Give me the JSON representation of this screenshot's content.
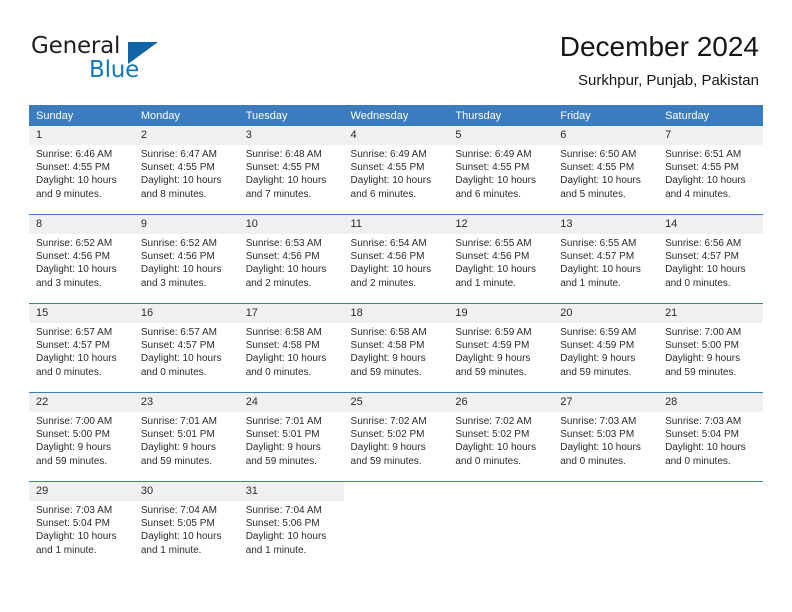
{
  "brand": {
    "name_top": "General",
    "name_bottom": "Blue",
    "triangle_color": "#1064a8",
    "blue_color": "#1277bc"
  },
  "header": {
    "title": "December 2024",
    "subtitle": "Surkhpur, Punjab, Pakistan"
  },
  "theme": {
    "header_bg": "#3b7cc0",
    "daynum_bg": "#f0f0f0",
    "text": "#2b2b2b"
  },
  "weekday_headers": [
    "Sunday",
    "Monday",
    "Tuesday",
    "Wednesday",
    "Thursday",
    "Friday",
    "Saturday"
  ],
  "weeks": [
    [
      {
        "day": "1",
        "sunrise": "Sunrise: 6:46 AM",
        "sunset": "Sunset: 4:55 PM",
        "daylight1": "Daylight: 10 hours",
        "daylight2": "and 9 minutes."
      },
      {
        "day": "2",
        "sunrise": "Sunrise: 6:47 AM",
        "sunset": "Sunset: 4:55 PM",
        "daylight1": "Daylight: 10 hours",
        "daylight2": "and 8 minutes."
      },
      {
        "day": "3",
        "sunrise": "Sunrise: 6:48 AM",
        "sunset": "Sunset: 4:55 PM",
        "daylight1": "Daylight: 10 hours",
        "daylight2": "and 7 minutes."
      },
      {
        "day": "4",
        "sunrise": "Sunrise: 6:49 AM",
        "sunset": "Sunset: 4:55 PM",
        "daylight1": "Daylight: 10 hours",
        "daylight2": "and 6 minutes."
      },
      {
        "day": "5",
        "sunrise": "Sunrise: 6:49 AM",
        "sunset": "Sunset: 4:55 PM",
        "daylight1": "Daylight: 10 hours",
        "daylight2": "and 6 minutes."
      },
      {
        "day": "6",
        "sunrise": "Sunrise: 6:50 AM",
        "sunset": "Sunset: 4:55 PM",
        "daylight1": "Daylight: 10 hours",
        "daylight2": "and 5 minutes."
      },
      {
        "day": "7",
        "sunrise": "Sunrise: 6:51 AM",
        "sunset": "Sunset: 4:55 PM",
        "daylight1": "Daylight: 10 hours",
        "daylight2": "and 4 minutes."
      }
    ],
    [
      {
        "day": "8",
        "sunrise": "Sunrise: 6:52 AM",
        "sunset": "Sunset: 4:56 PM",
        "daylight1": "Daylight: 10 hours",
        "daylight2": "and 3 minutes."
      },
      {
        "day": "9",
        "sunrise": "Sunrise: 6:52 AM",
        "sunset": "Sunset: 4:56 PM",
        "daylight1": "Daylight: 10 hours",
        "daylight2": "and 3 minutes."
      },
      {
        "day": "10",
        "sunrise": "Sunrise: 6:53 AM",
        "sunset": "Sunset: 4:56 PM",
        "daylight1": "Daylight: 10 hours",
        "daylight2": "and 2 minutes."
      },
      {
        "day": "11",
        "sunrise": "Sunrise: 6:54 AM",
        "sunset": "Sunset: 4:56 PM",
        "daylight1": "Daylight: 10 hours",
        "daylight2": "and 2 minutes."
      },
      {
        "day": "12",
        "sunrise": "Sunrise: 6:55 AM",
        "sunset": "Sunset: 4:56 PM",
        "daylight1": "Daylight: 10 hours",
        "daylight2": "and 1 minute."
      },
      {
        "day": "13",
        "sunrise": "Sunrise: 6:55 AM",
        "sunset": "Sunset: 4:57 PM",
        "daylight1": "Daylight: 10 hours",
        "daylight2": "and 1 minute."
      },
      {
        "day": "14",
        "sunrise": "Sunrise: 6:56 AM",
        "sunset": "Sunset: 4:57 PM",
        "daylight1": "Daylight: 10 hours",
        "daylight2": "and 0 minutes."
      }
    ],
    [
      {
        "day": "15",
        "sunrise": "Sunrise: 6:57 AM",
        "sunset": "Sunset: 4:57 PM",
        "daylight1": "Daylight: 10 hours",
        "daylight2": "and 0 minutes."
      },
      {
        "day": "16",
        "sunrise": "Sunrise: 6:57 AM",
        "sunset": "Sunset: 4:57 PM",
        "daylight1": "Daylight: 10 hours",
        "daylight2": "and 0 minutes."
      },
      {
        "day": "17",
        "sunrise": "Sunrise: 6:58 AM",
        "sunset": "Sunset: 4:58 PM",
        "daylight1": "Daylight: 10 hours",
        "daylight2": "and 0 minutes."
      },
      {
        "day": "18",
        "sunrise": "Sunrise: 6:58 AM",
        "sunset": "Sunset: 4:58 PM",
        "daylight1": "Daylight: 9 hours",
        "daylight2": "and 59 minutes."
      },
      {
        "day": "19",
        "sunrise": "Sunrise: 6:59 AM",
        "sunset": "Sunset: 4:59 PM",
        "daylight1": "Daylight: 9 hours",
        "daylight2": "and 59 minutes."
      },
      {
        "day": "20",
        "sunrise": "Sunrise: 6:59 AM",
        "sunset": "Sunset: 4:59 PM",
        "daylight1": "Daylight: 9 hours",
        "daylight2": "and 59 minutes."
      },
      {
        "day": "21",
        "sunrise": "Sunrise: 7:00 AM",
        "sunset": "Sunset: 5:00 PM",
        "daylight1": "Daylight: 9 hours",
        "daylight2": "and 59 minutes."
      }
    ],
    [
      {
        "day": "22",
        "sunrise": "Sunrise: 7:00 AM",
        "sunset": "Sunset: 5:00 PM",
        "daylight1": "Daylight: 9 hours",
        "daylight2": "and 59 minutes."
      },
      {
        "day": "23",
        "sunrise": "Sunrise: 7:01 AM",
        "sunset": "Sunset: 5:01 PM",
        "daylight1": "Daylight: 9 hours",
        "daylight2": "and 59 minutes."
      },
      {
        "day": "24",
        "sunrise": "Sunrise: 7:01 AM",
        "sunset": "Sunset: 5:01 PM",
        "daylight1": "Daylight: 9 hours",
        "daylight2": "and 59 minutes."
      },
      {
        "day": "25",
        "sunrise": "Sunrise: 7:02 AM",
        "sunset": "Sunset: 5:02 PM",
        "daylight1": "Daylight: 9 hours",
        "daylight2": "and 59 minutes."
      },
      {
        "day": "26",
        "sunrise": "Sunrise: 7:02 AM",
        "sunset": "Sunset: 5:02 PM",
        "daylight1": "Daylight: 10 hours",
        "daylight2": "and 0 minutes."
      },
      {
        "day": "27",
        "sunrise": "Sunrise: 7:03 AM",
        "sunset": "Sunset: 5:03 PM",
        "daylight1": "Daylight: 10 hours",
        "daylight2": "and 0 minutes."
      },
      {
        "day": "28",
        "sunrise": "Sunrise: 7:03 AM",
        "sunset": "Sunset: 5:04 PM",
        "daylight1": "Daylight: 10 hours",
        "daylight2": "and 0 minutes."
      }
    ],
    [
      {
        "day": "29",
        "sunrise": "Sunrise: 7:03 AM",
        "sunset": "Sunset: 5:04 PM",
        "daylight1": "Daylight: 10 hours",
        "daylight2": "and 1 minute."
      },
      {
        "day": "30",
        "sunrise": "Sunrise: 7:04 AM",
        "sunset": "Sunset: 5:05 PM",
        "daylight1": "Daylight: 10 hours",
        "daylight2": "and 1 minute."
      },
      {
        "day": "31",
        "sunrise": "Sunrise: 7:04 AM",
        "sunset": "Sunset: 5:06 PM",
        "daylight1": "Daylight: 10 hours",
        "daylight2": "and 1 minute."
      },
      {
        "day": "",
        "sunrise": "",
        "sunset": "",
        "daylight1": "",
        "daylight2": ""
      },
      {
        "day": "",
        "sunrise": "",
        "sunset": "",
        "daylight1": "",
        "daylight2": ""
      },
      {
        "day": "",
        "sunrise": "",
        "sunset": "",
        "daylight1": "",
        "daylight2": ""
      },
      {
        "day": "",
        "sunrise": "",
        "sunset": "",
        "daylight1": "",
        "daylight2": ""
      }
    ]
  ]
}
